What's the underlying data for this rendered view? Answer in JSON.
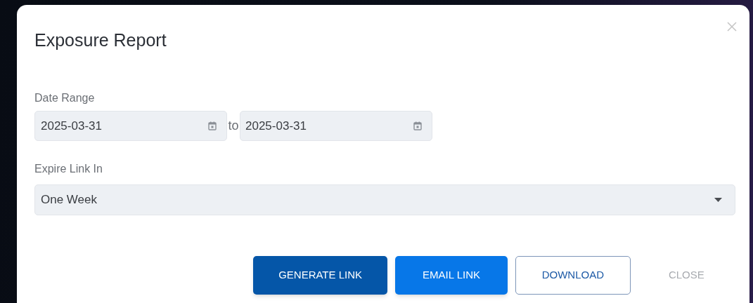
{
  "dialog": {
    "title": "Exposure Report",
    "date_range": {
      "label": "Date Range",
      "from": "2025-03-31",
      "separator": "to",
      "to": "2025-03-31"
    },
    "expire": {
      "label": "Expire Link In",
      "value": "One Week"
    },
    "buttons": [
      {
        "label": "GENERATE LINK",
        "kind": "dark"
      },
      {
        "label": "EMAIL LINK",
        "kind": "primary"
      },
      {
        "label": "DOWNLOAD",
        "kind": "outline"
      },
      {
        "label": "CLOSE",
        "kind": "text"
      }
    ]
  }
}
